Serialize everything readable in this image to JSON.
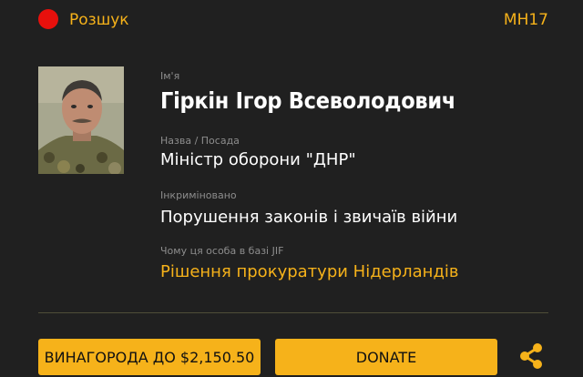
{
  "header": {
    "status_label": "Розшук",
    "case_tag": "MH17",
    "status_color": "#e8100c"
  },
  "profile": {
    "name_label": "Ім'я",
    "name": "Гіркін Ігор Всеволодович",
    "position_label": "Назва / Посада",
    "position": "Міністр оборони \"ДНР\"",
    "charge_label": "Інкриміновано",
    "charge": "Порушення законів і звичаїв війни",
    "reason_label": "Чому ця особа в базі JIF",
    "reason": "Рішення прокуратури Нідерландів"
  },
  "actions": {
    "reward_label": "ВИНАГОРОДА ДО $2,150.50",
    "donate_label": "DONATE"
  },
  "icons": {
    "status": "status-dot-icon",
    "share": "share-icon"
  },
  "colors": {
    "background": "#202020",
    "accent": "#f6b21a",
    "text": "#ffffff",
    "muted": "#8d8d8d"
  }
}
